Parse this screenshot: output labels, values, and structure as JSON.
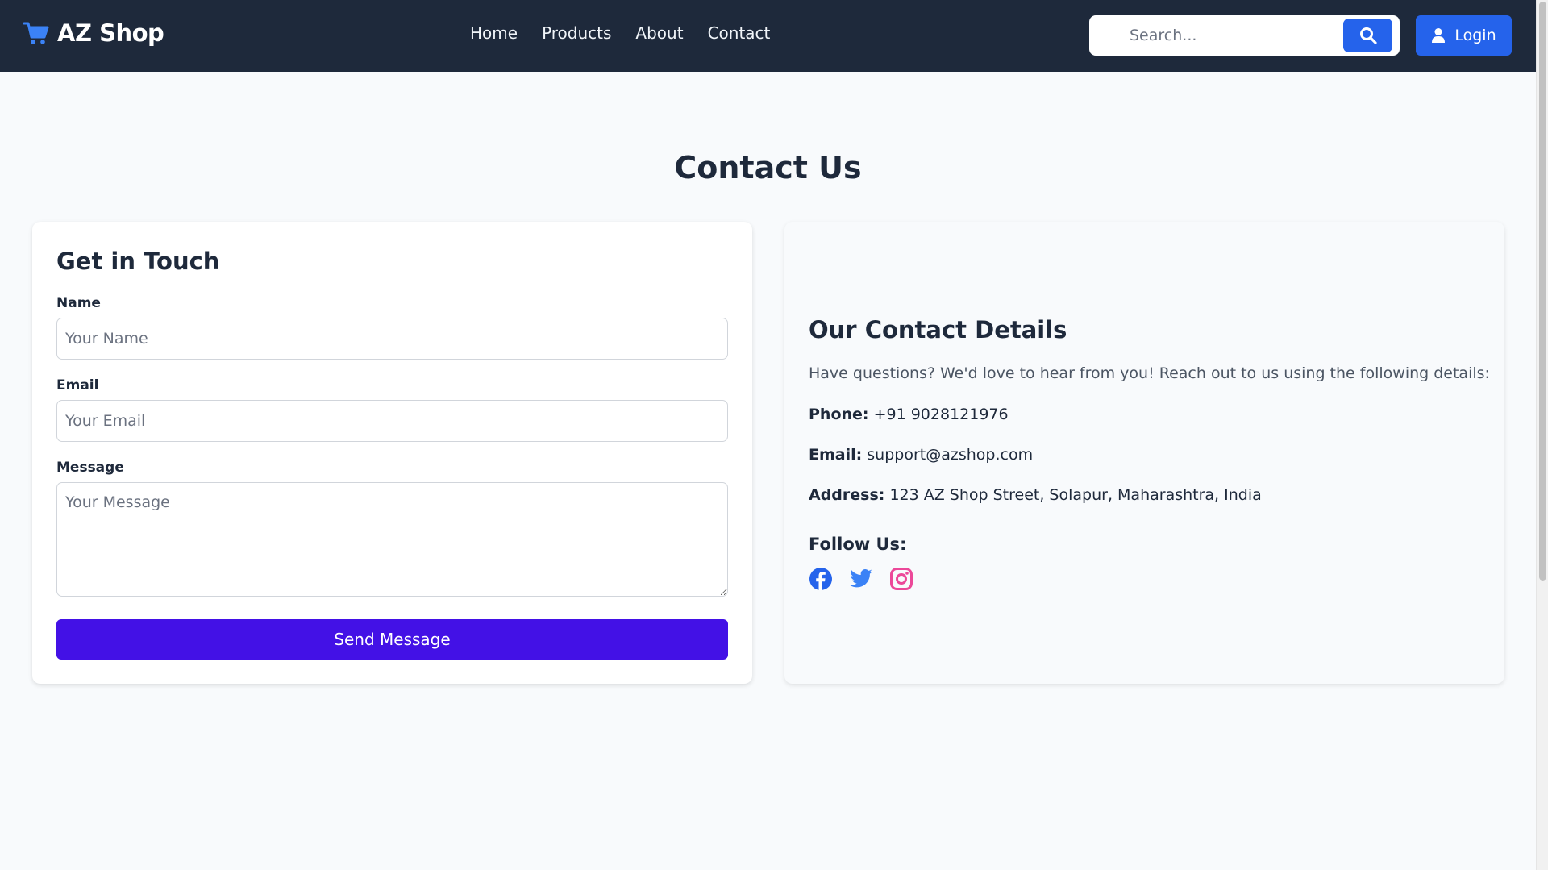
{
  "header": {
    "brand": "AZ Shop",
    "nav": [
      {
        "label": "Home"
      },
      {
        "label": "Products"
      },
      {
        "label": "About"
      },
      {
        "label": "Contact"
      }
    ],
    "search_placeholder": "Search...",
    "login_label": "Login"
  },
  "page": {
    "title": "Contact Us"
  },
  "form": {
    "heading": "Get in Touch",
    "name_label": "Name",
    "name_placeholder": "Your Name",
    "email_label": "Email",
    "email_placeholder": "Your Email",
    "message_label": "Message",
    "message_placeholder": "Your Message",
    "submit_label": "Send Message"
  },
  "details": {
    "heading": "Our Contact Details",
    "intro": "Have questions? We'd love to hear from you! Reach out to us using the following details:",
    "phone_key": "Phone:",
    "phone": "+91 9028121976",
    "email_key": "Email:",
    "email": "support@azshop.com",
    "address_key": "Address:",
    "address": "123 AZ Shop Street, Solapur, Maharashtra, India",
    "follow_heading": "Follow Us:",
    "social_icons": [
      "facebook-icon",
      "twitter-icon",
      "instagram-icon"
    ]
  },
  "colors": {
    "navbar": "#1e293b",
    "accent_blue": "#2563eb",
    "send_button": "#4311e6",
    "facebook": "#2563eb",
    "twitter": "#3b82f6",
    "instagram": "#ec4899"
  }
}
